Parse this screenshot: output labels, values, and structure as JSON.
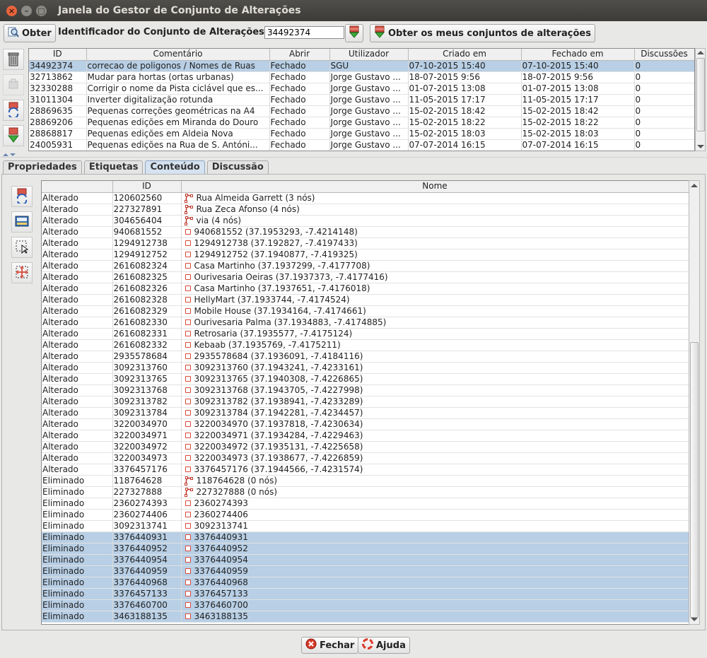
{
  "window": {
    "title": "Janela do Gestor de Conjunto de Alterações"
  },
  "toolbar": {
    "fetch_label": "Obter",
    "id_label": "Identificador do Conjunto de Alterações:",
    "id_value": "34492374",
    "my_changesets_label": "Obter os meus conjuntos de alterações"
  },
  "changesets": {
    "columns": [
      "ID",
      "Comentário",
      "Abrir",
      "Utilizador",
      "Criado em",
      "Fechado em",
      "Discussões"
    ],
    "rows": [
      [
        "34492374",
        "correcao de poligonos / Nomes de Ruas",
        "Fechado",
        "SGU",
        "07-10-2015 15:40",
        "07-10-2015 15:40",
        "0"
      ],
      [
        "32713862",
        "Mudar para hortas (ortas urbanas)",
        "Fechado",
        "Jorge Gustavo ...",
        "18-07-2015 9:56",
        "18-07-2015 9:56",
        "0"
      ],
      [
        "32330288",
        "Corrigir o nome da Pista ciclável que es...",
        "Fechado",
        "Jorge Gustavo ...",
        "01-07-2015 13:08",
        "01-07-2015 13:08",
        "0"
      ],
      [
        "31011304",
        "Inverter digitalização rotunda",
        "Fechado",
        "Jorge Gustavo ...",
        "11-05-2015 17:17",
        "11-05-2015 17:17",
        "0"
      ],
      [
        "28869635",
        "Pequenas correções geométricas na A4",
        "Fechado",
        "Jorge Gustavo ...",
        "15-02-2015 18:42",
        "15-02-2015 18:42",
        "0"
      ],
      [
        "28869206",
        "Pequenas edições em Miranda do Douro",
        "Fechado",
        "Jorge Gustavo ...",
        "15-02-2015 18:22",
        "15-02-2015 18:22",
        "0"
      ],
      [
        "28868817",
        "Pequenas edições em Aldeia Nova",
        "Fechado",
        "Jorge Gustavo ...",
        "15-02-2015 18:03",
        "15-02-2015 18:03",
        "0"
      ],
      [
        "24005931",
        "Pequenas edições na Rua de S. Antóni...",
        "Fechado",
        "Jorge Gustavo ...",
        "07-07-2014 16:15",
        "07-07-2014 16:15",
        "0"
      ]
    ]
  },
  "tabs": [
    "Propriedades",
    "Etiquetas",
    "Conteúdo",
    "Discussão"
  ],
  "content": {
    "columns": [
      "",
      "ID",
      "Nome"
    ],
    "rows": [
      [
        "Alterado",
        "120602560",
        "way",
        "Rua Almeida Garrett (3 nós)"
      ],
      [
        "Alterado",
        "227327891",
        "way",
        "Rua Zeca Afonso (4 nós)"
      ],
      [
        "Alterado",
        "304656404",
        "way",
        "via (4 nós)"
      ],
      [
        "Alterado",
        "940681552",
        "node",
        "940681552 (37.1953293, -7.4214148)"
      ],
      [
        "Alterado",
        "1294912738",
        "node",
        "1294912738 (37.192827, -7.4197433)"
      ],
      [
        "Alterado",
        "1294912752",
        "node",
        "1294912752 (37.1940877, -7.419325)"
      ],
      [
        "Alterado",
        "2616082324",
        "node",
        "Casa Martinho (37.1937299, -7.4177708)"
      ],
      [
        "Alterado",
        "2616082325",
        "node",
        "Ourivesaria Oeiras (37.1937373, -7.4177416)"
      ],
      [
        "Alterado",
        "2616082326",
        "node",
        "Casa Martinho (37.1937651, -7.4176018)"
      ],
      [
        "Alterado",
        "2616082328",
        "node",
        "HellyMart (37.1933744, -7.4174524)"
      ],
      [
        "Alterado",
        "2616082329",
        "node",
        "Mobile House (37.1934164, -7.4174661)"
      ],
      [
        "Alterado",
        "2616082330",
        "node",
        "Ourivesaria Palma (37.1934883, -7.4174885)"
      ],
      [
        "Alterado",
        "2616082331",
        "node",
        "Retrosaria (37.1935577, -7.4175124)"
      ],
      [
        "Alterado",
        "2616082332",
        "node",
        "Kebaab (37.1935769, -7.4175211)"
      ],
      [
        "Alterado",
        "2935578684",
        "node",
        "2935578684 (37.1936091, -7.4184116)"
      ],
      [
        "Alterado",
        "3092313760",
        "node",
        "3092313760 (37.1943241, -7.4233161)"
      ],
      [
        "Alterado",
        "3092313765",
        "node",
        "3092313765 (37.1940308, -7.4226865)"
      ],
      [
        "Alterado",
        "3092313768",
        "node",
        "3092313768 (37.1943705, -7.4227998)"
      ],
      [
        "Alterado",
        "3092313782",
        "node",
        "3092313782 (37.1938941, -7.4233289)"
      ],
      [
        "Alterado",
        "3092313784",
        "node",
        "3092313784 (37.1942281, -7.4234457)"
      ],
      [
        "Alterado",
        "3220034970",
        "node",
        "3220034970 (37.1937818, -7.4230634)"
      ],
      [
        "Alterado",
        "3220034971",
        "node",
        "3220034971 (37.1934284, -7.4229463)"
      ],
      [
        "Alterado",
        "3220034972",
        "node",
        "3220034972 (37.1935131, -7.4225658)"
      ],
      [
        "Alterado",
        "3220034973",
        "node",
        "3220034973 (37.1938677, -7.4226859)"
      ],
      [
        "Alterado",
        "3376457176",
        "node",
        "3376457176 (37.1944566, -7.4231574)"
      ],
      [
        "Eliminado",
        "118764628",
        "way",
        "118764628 (0 nós)"
      ],
      [
        "Eliminado",
        "227327888",
        "way",
        "227327888 (0 nós)"
      ],
      [
        "Eliminado",
        "2360274393",
        "node",
        "2360274393"
      ],
      [
        "Eliminado",
        "2360274406",
        "node",
        "2360274406"
      ],
      [
        "Eliminado",
        "3092313741",
        "node",
        "3092313741"
      ],
      [
        "Eliminado",
        "3376440931",
        "node",
        "3376440931"
      ],
      [
        "Eliminado",
        "3376440952",
        "node",
        "3376440952"
      ],
      [
        "Eliminado",
        "3376440954",
        "node",
        "3376440954"
      ],
      [
        "Eliminado",
        "3376440959",
        "node",
        "3376440959"
      ],
      [
        "Eliminado",
        "3376440968",
        "node",
        "3376440968"
      ],
      [
        "Eliminado",
        "3376457133",
        "node",
        "3376457133"
      ],
      [
        "Eliminado",
        "3376460700",
        "node",
        "3376460700"
      ],
      [
        "Eliminado",
        "3463188135",
        "node",
        "3463188135"
      ]
    ],
    "selected_from_row": 30
  },
  "footer": {
    "close_label": "Fechar",
    "help_label": "Ajuda"
  },
  "icons": {
    "fetch": "magnifier-icon",
    "delete": "trash-icon",
    "close_changeset": "close-changeset-icon",
    "update": "refresh-icon",
    "download": "download-icon",
    "way": "way-icon",
    "node": "node-icon",
    "close": "cancel-icon",
    "help": "lifebuoy-icon"
  },
  "colors": {
    "selection": "#b8cfe5",
    "titlebar": "#3c3b37",
    "close_button": "#e8643c"
  }
}
